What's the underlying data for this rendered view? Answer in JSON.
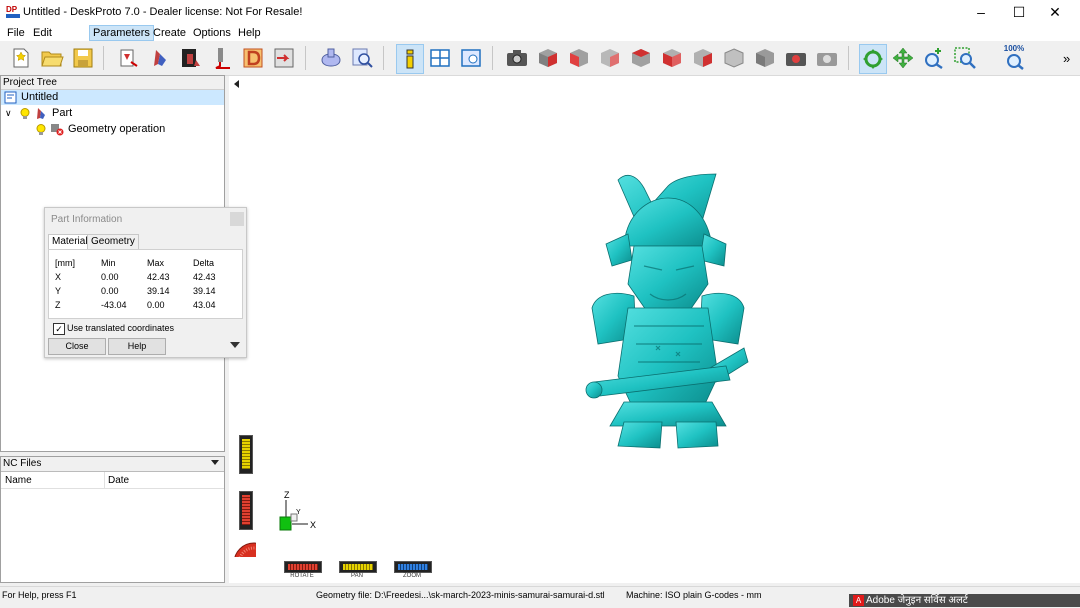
{
  "window": {
    "title": "Untitled - DeskProto 7.0 - Dealer license: Not For Resale!",
    "icon_text": "DP"
  },
  "menu": [
    "File",
    "Edit",
    "Parameters",
    "Create",
    "Options",
    "Help"
  ],
  "menu_active": "Parameters",
  "toolbar": {
    "zoom_label": "100%",
    "right_overflow": "»"
  },
  "project_tree": {
    "header": "Project Tree",
    "root": "Untitled",
    "part": "Part",
    "operation": "Geometry operation"
  },
  "nc_files": {
    "header": "NC Files",
    "columns": [
      "Name",
      "Date"
    ]
  },
  "part_info": {
    "title": "Part Information",
    "tabs": [
      "Material",
      "Geometry"
    ],
    "active_tab": "Material",
    "headers": [
      "[mm]",
      "Min",
      "Max",
      "Delta"
    ],
    "rows": [
      {
        "axis": "X",
        "min": "0.00",
        "max": "42.43",
        "delta": "42.43"
      },
      {
        "axis": "Y",
        "min": "0.00",
        "max": "39.14",
        "delta": "39.14"
      },
      {
        "axis": "Z",
        "min": "-43.04",
        "max": "0.00",
        "delta": "43.04"
      }
    ],
    "checkbox_label": "Use translated coordinates",
    "checkbox_checked": true,
    "close_label": "Close",
    "help_label": "Help"
  },
  "view_controls": {
    "rotate": "ROTATE",
    "pan": "PAN",
    "zoom": "ZOOM"
  },
  "axes": {
    "x": "X",
    "y": "Y",
    "z": "Z"
  },
  "status": {
    "help": "For Help, press F1",
    "geometry": "Geometry file: D:\\Freedesi...\\sk-march-2023-minis-samurai-samurai-d.stl",
    "machine": "Machine: ISO plain G-codes - mm"
  },
  "notification": {
    "app": "Adobe",
    "text": "जेनुइन सर्विस अलर्ट"
  },
  "colors": {
    "model": "#1fc2c2",
    "model_shade": "#0f8f8f",
    "accent": "#0078d7"
  }
}
